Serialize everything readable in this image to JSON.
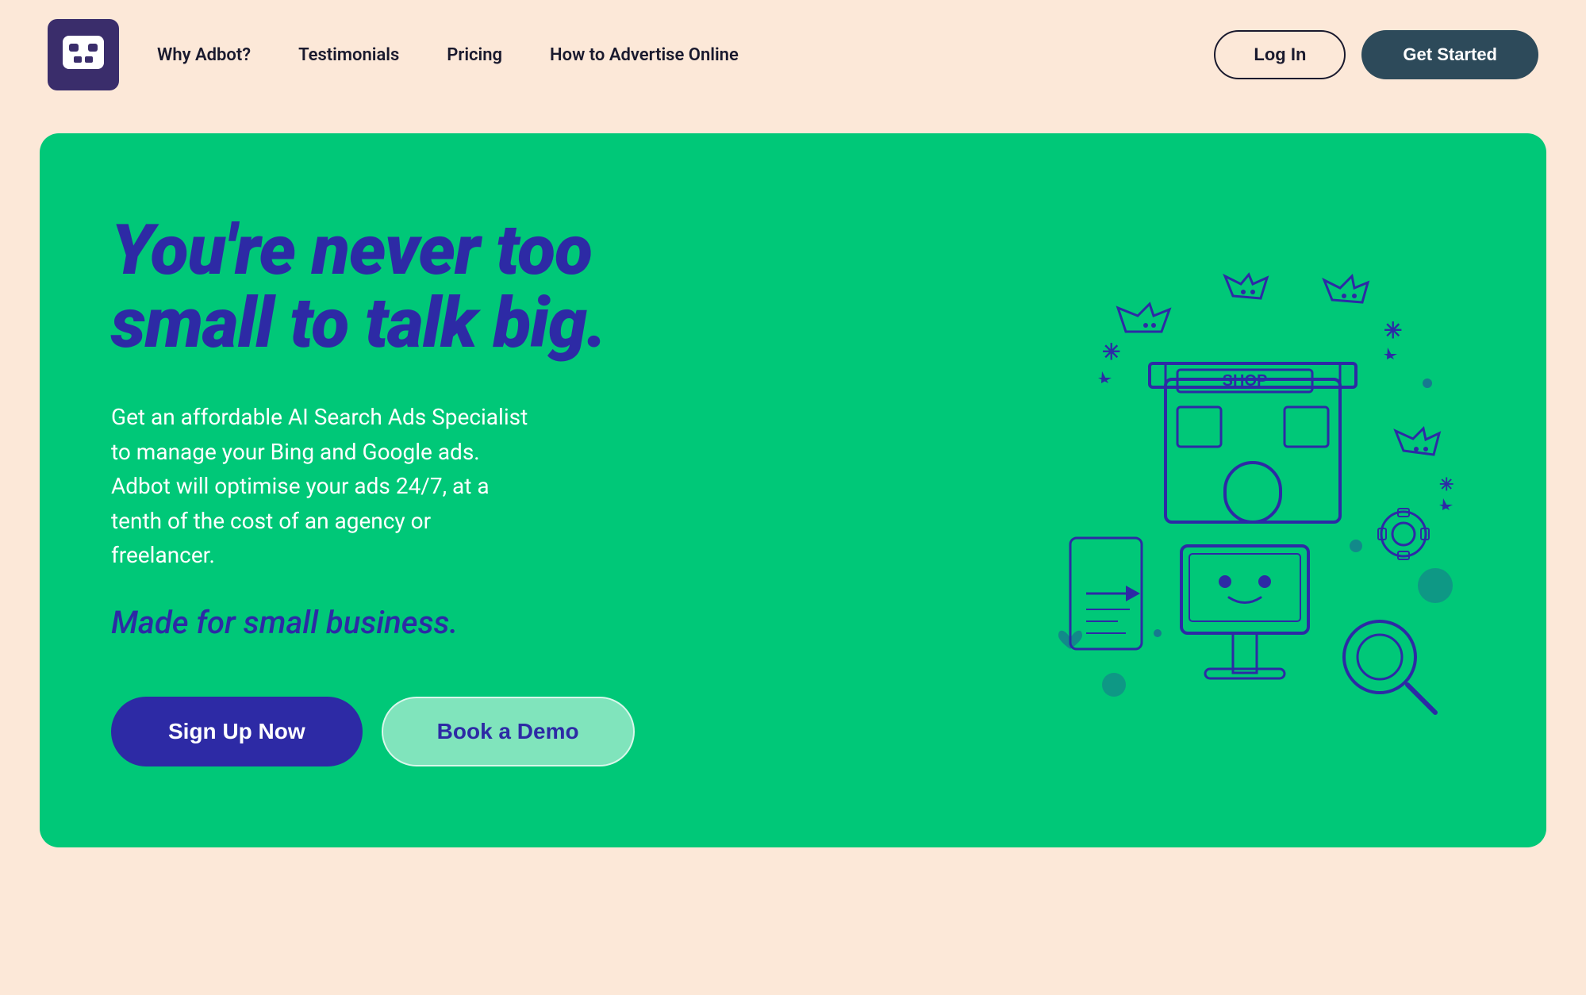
{
  "header": {
    "logo_alt": "Adbot logo",
    "nav": {
      "items": [
        {
          "id": "why-adbot",
          "label": "Why Adbot?"
        },
        {
          "id": "testimonials",
          "label": "Testimonials"
        },
        {
          "id": "pricing",
          "label": "Pricing"
        },
        {
          "id": "how-to-advertise",
          "label": "How to Advertise Online"
        }
      ]
    },
    "login_label": "Log In",
    "get_started_label": "Get Started"
  },
  "hero": {
    "title": "You're never too small to talk big.",
    "description": "Get an affordable AI Search Ads Specialist to manage your Bing and Google ads. Adbot will optimise your ads 24/7, at a tenth of the cost of an agency or freelancer.",
    "tagline": "Made for small business.",
    "cta_primary": "Sign Up Now",
    "cta_secondary": "Book a Demo"
  },
  "colors": {
    "background": "#fce8d8",
    "hero_bg": "#00c878",
    "hero_title": "#2d2aa5",
    "hero_text": "#ffffff",
    "btn_primary": "#2d2aa5",
    "btn_secondary_border": "rgba(255,255,255,0.7)",
    "nav_dark": "#2d4a5a",
    "logo_bg": "#3a2d6b"
  }
}
